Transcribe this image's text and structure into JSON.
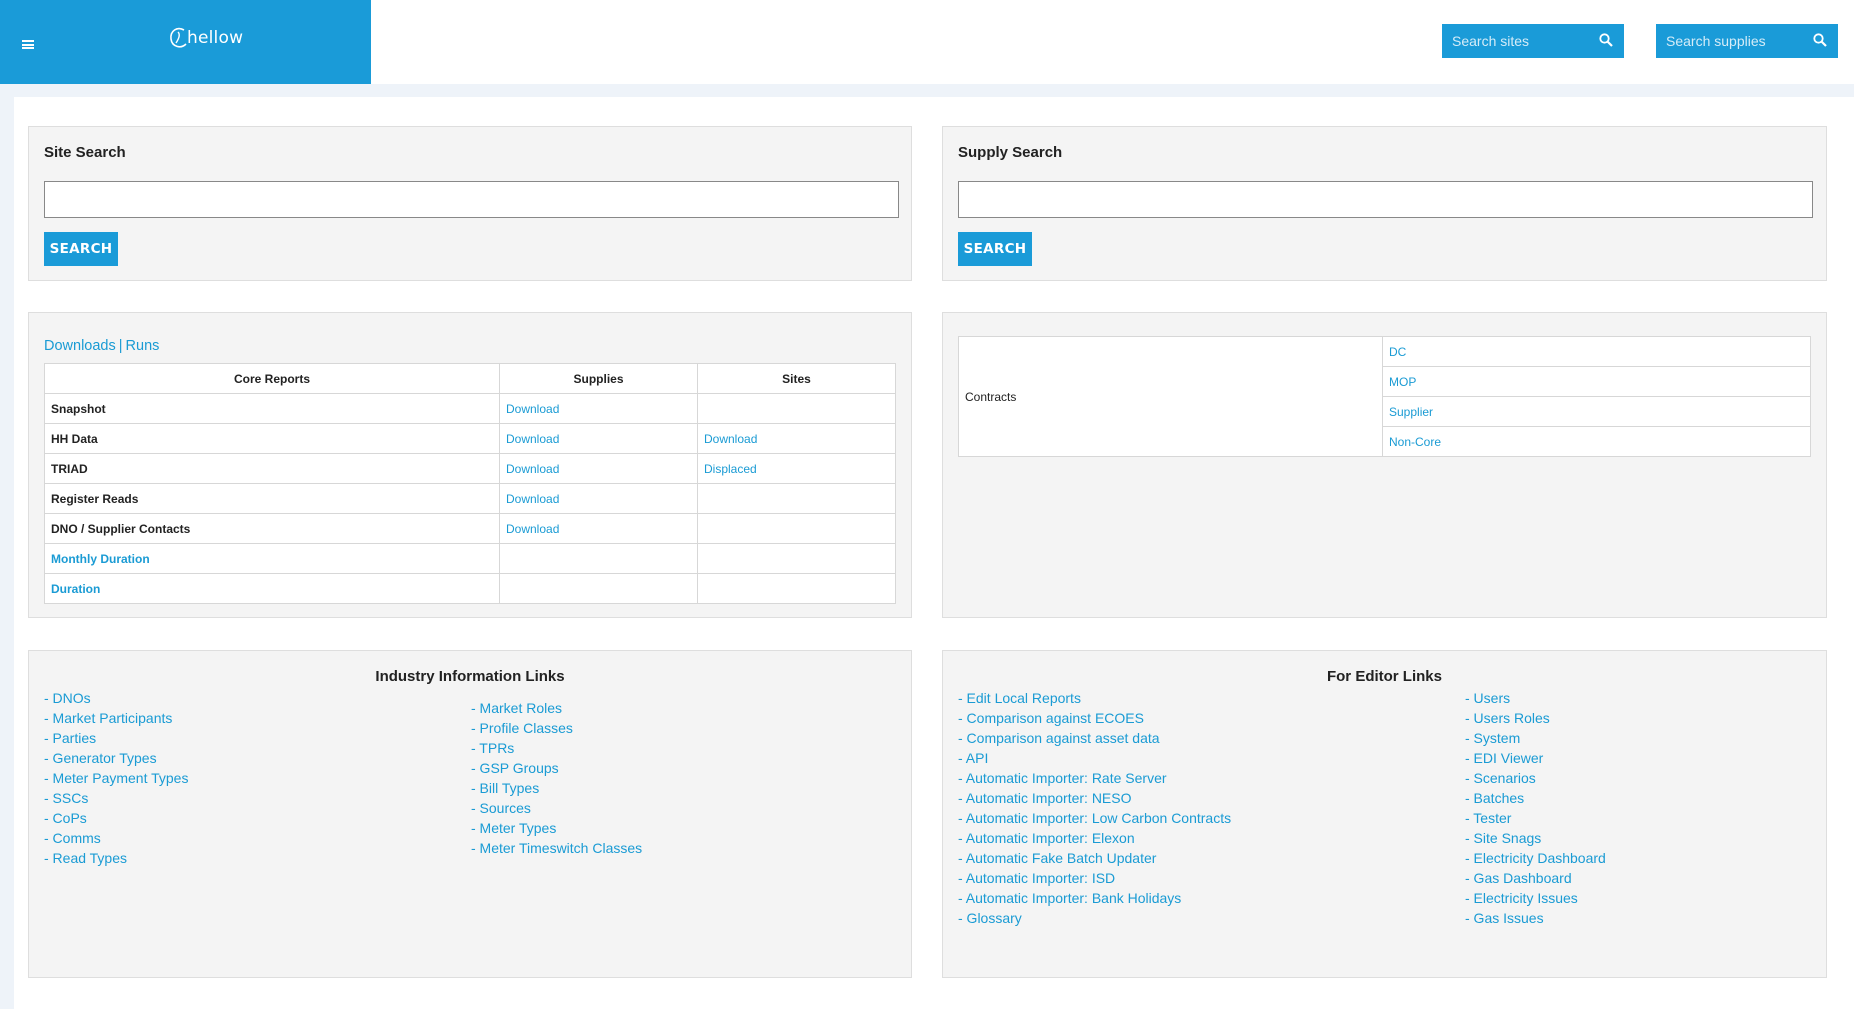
{
  "header": {
    "brand": "hellow",
    "search_sites_placeholder": "Search sites",
    "search_supplies_placeholder": "Search supplies",
    "brand_color": "#1a9bd8"
  },
  "site_search": {
    "title": "Site Search",
    "button": "SEARCH",
    "value": ""
  },
  "supply_search": {
    "title": "Supply Search",
    "button": "SEARCH",
    "value": ""
  },
  "reports": {
    "tab_downloads": "Downloads",
    "tab_separator": "|",
    "tab_runs": "Runs",
    "columns": [
      "Core Reports",
      "Supplies",
      "Sites"
    ],
    "rows": [
      {
        "name": "Snapshot",
        "supplies": "Download",
        "sites": ""
      },
      {
        "name": "HH Data",
        "supplies": "Download",
        "sites": "Download"
      },
      {
        "name": "TRIAD",
        "supplies": "Download",
        "sites": "Displaced"
      },
      {
        "name": "Register Reads",
        "supplies": "Download",
        "sites": ""
      },
      {
        "name": "DNO / Supplier Contacts",
        "supplies": "Download",
        "sites": ""
      },
      {
        "name": "Monthly Duration",
        "supplies": "",
        "sites": ""
      },
      {
        "name": "Duration",
        "supplies": "",
        "sites": ""
      }
    ]
  },
  "contracts": {
    "label": "Contracts",
    "items": [
      "DC",
      "MOP",
      "Supplier",
      "Non-Core"
    ]
  },
  "industry_links": {
    "title": "Industry Information Links",
    "col1": [
      "- DNOs",
      "- Market Participants",
      "- Parties",
      "- Generator Types",
      "- Meter Payment Types",
      "- SSCs",
      "- CoPs",
      "- Comms",
      "- Read Types"
    ],
    "col2": [
      "- Market Roles",
      "- Profile Classes",
      "- TPRs",
      "- GSP Groups",
      "- Bill Types",
      "- Sources",
      "- Meter Types",
      "- Meter Timeswitch Classes"
    ]
  },
  "editor_links": {
    "title": "For Editor Links",
    "col1": [
      "- Edit Local Reports",
      "- Comparison against ECOES",
      "- Comparison against asset data",
      "- API",
      "- Automatic Importer: Rate Server",
      "- Automatic Importer: NESO",
      "- Automatic Importer: Low Carbon Contracts",
      "- Automatic Importer: Elexon",
      "- Automatic Fake Batch Updater",
      "- Automatic Importer: ISD",
      "- Automatic Importer: Bank Holidays",
      "- Glossary"
    ],
    "col2": [
      "- Users",
      "- Users Roles",
      "- System",
      "- EDI Viewer",
      "- Scenarios",
      "- Batches",
      "- Tester",
      "- Site Snags",
      "- Electricity Dashboard",
      "- Gas Dashboard",
      "- Electricity Issues",
      "- Gas Issues"
    ]
  }
}
